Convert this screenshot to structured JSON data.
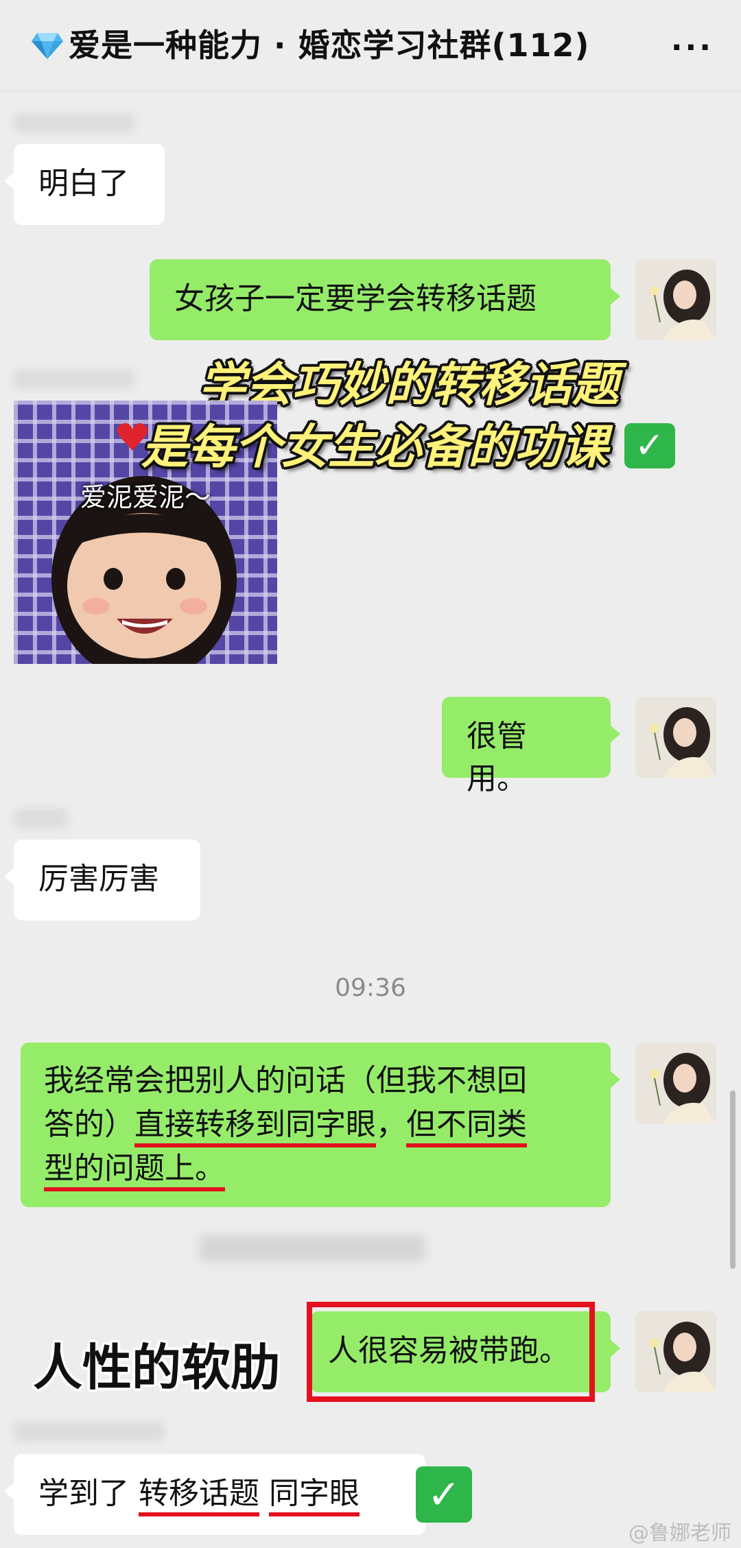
{
  "header": {
    "title": "爱是一种能力 · 婚恋学习社群(112)",
    "more": "···",
    "gem_icon": "blue-diamond-icon"
  },
  "messages": {
    "m1": "明白了",
    "m2": "女孩子一定要学会转移话题",
    "m3": "很管用。",
    "m4": "厉害厉害",
    "m5_parts": [
      "我经常会把别人的问话（但我不想回",
      "答的）",
      "直接转移到同字眼",
      "，",
      "但不同类",
      "型的问题上。"
    ],
    "m6": "人很容易被带跑。",
    "m7_parts": [
      "学到了 ",
      "转移话题",
      " ",
      "同字眼"
    ]
  },
  "sticker": {
    "caption": "爱泥爱泥～"
  },
  "timestamp": "09:36",
  "overlays": {
    "line1": "学会巧妙的转移话题",
    "line2": "是每个女生必备的功课",
    "side": "人性的软肋",
    "check": "✓"
  },
  "watermark": "@鲁娜老师",
  "colors": {
    "bubble_green": "#95ec69",
    "bubble_white": "#ffffff",
    "underline_red": "#e3101e",
    "overlay_yellow": "#fff27a"
  }
}
